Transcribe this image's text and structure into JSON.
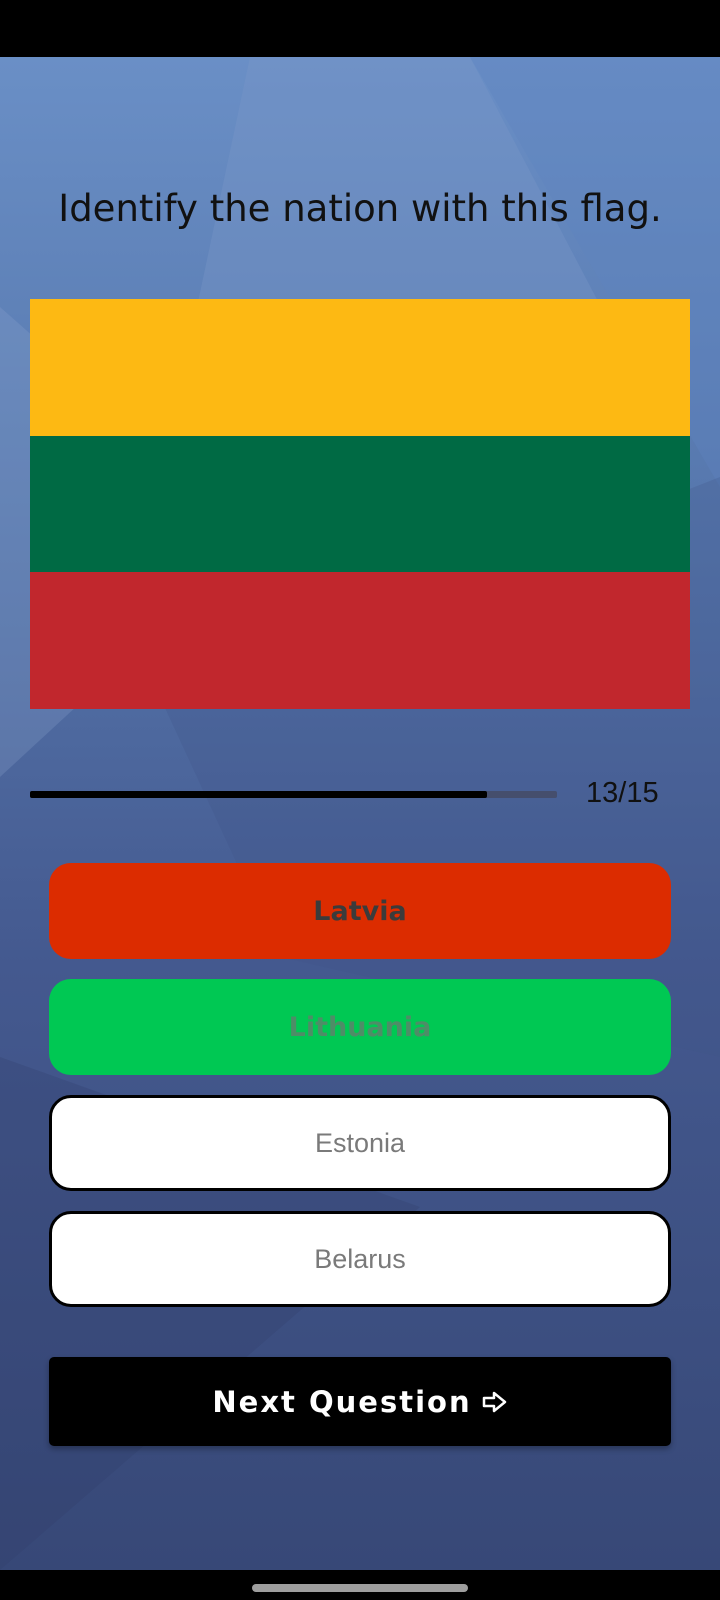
{
  "question": "Identify the nation with this flag.",
  "flag": {
    "stripes": [
      "#fdb913",
      "#006a44",
      "#c1272d"
    ]
  },
  "progress": {
    "current": 13,
    "total": 15,
    "label": "13/15"
  },
  "options": [
    {
      "label": "Latvia",
      "state": "wrong"
    },
    {
      "label": "Lithuania",
      "state": "correct"
    },
    {
      "label": "Estonia",
      "state": "unselected"
    },
    {
      "label": "Belarus",
      "state": "unselected"
    }
  ],
  "next_button": {
    "label": "Next Question",
    "icon": "arrow-right-icon"
  },
  "colors": {
    "wrong": "#dc2c00",
    "correct": "#00c853"
  }
}
